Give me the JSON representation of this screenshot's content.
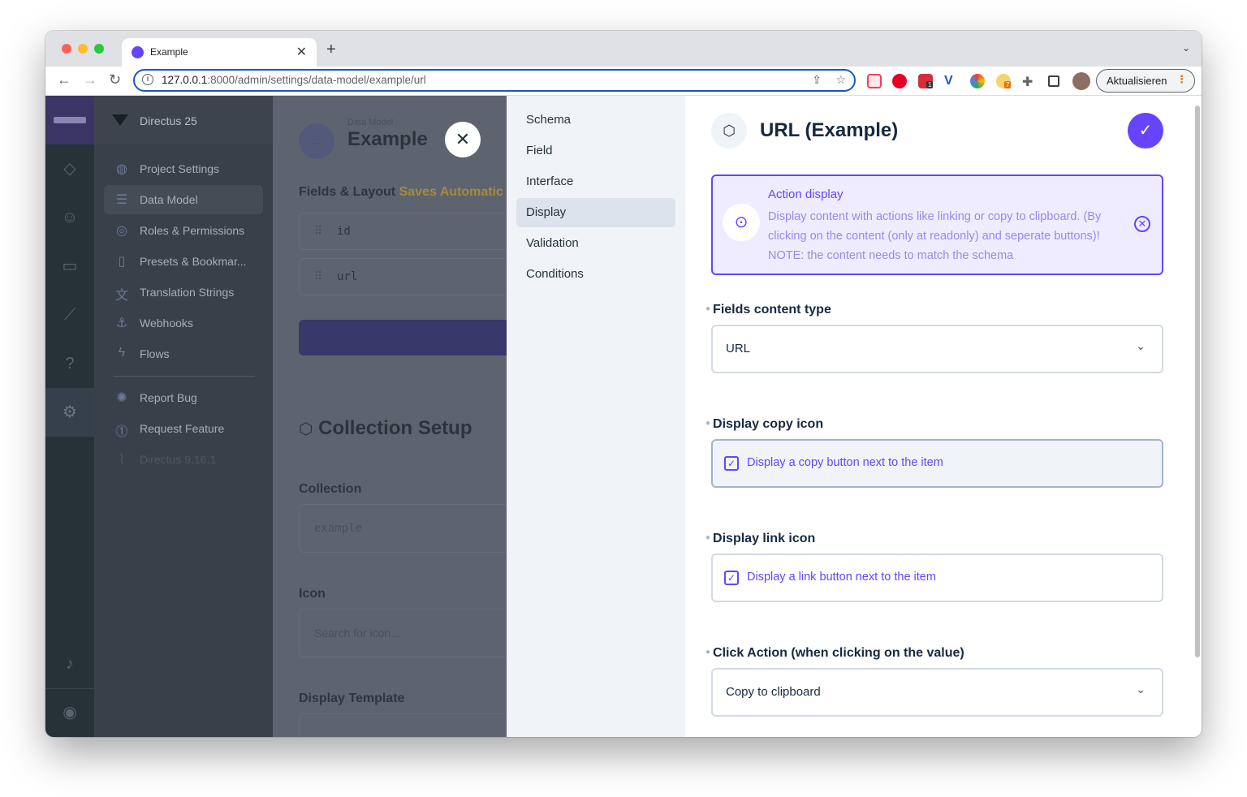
{
  "browser": {
    "tab_title": "Example",
    "url_host": "127.0.0.1",
    "url_rest": ":8000/admin/settings/data-model/example/url",
    "update_label": "Aktualisieren",
    "ext_badge_1": "1",
    "ext_badge_2": "7"
  },
  "sidebar": {
    "project_name": "Directus 25",
    "items": [
      {
        "label": "Project Settings",
        "icon": "globe-icon"
      },
      {
        "label": "Data Model",
        "icon": "list-icon"
      },
      {
        "label": "Roles & Permissions",
        "icon": "roles-icon"
      },
      {
        "label": "Presets & Bookmar...",
        "icon": "bookmark-icon"
      },
      {
        "label": "Translation Strings",
        "icon": "translate-icon"
      },
      {
        "label": "Webhooks",
        "icon": "anchor-icon"
      },
      {
        "label": "Flows",
        "icon": "bolt-icon"
      }
    ],
    "extra": [
      {
        "label": "Report Bug",
        "icon": "bug-icon"
      },
      {
        "label": "Request Feature",
        "icon": "feature-icon"
      },
      {
        "label": "Directus 9.16.1",
        "icon": "rabbit-icon"
      }
    ]
  },
  "main": {
    "breadcrumb": "Data Model",
    "title": "Example",
    "fields_layout_label": "Fields & Layout",
    "saves_label": "Saves Automatic",
    "fields": [
      "id",
      "url"
    ],
    "collection_setup_title": "Collection Setup",
    "collection_label": "Collection",
    "collection_value": "example",
    "icon_label": "Icon",
    "icon_placeholder": "Search for icon...",
    "display_template_label": "Display Template"
  },
  "drawer_tabs": [
    "Schema",
    "Field",
    "Interface",
    "Display",
    "Validation",
    "Conditions"
  ],
  "drawer": {
    "title": "URL (Example)",
    "notice": {
      "title": "Action display",
      "text": "Display content with actions like linking or copy to clipboard. (By clicking on the content (only at readonly) and seperate buttons)! NOTE: the content needs to match the schema"
    },
    "fields": {
      "content_type_label": "Fields content type",
      "content_type_value": "URL",
      "copy_icon_label": "Display copy icon",
      "copy_icon_text": "Display a copy button next to the item",
      "link_icon_label": "Display link icon",
      "link_icon_text": "Display a link button next to the item",
      "click_action_label": "Click Action (when clicking on the value)",
      "click_action_value": "Copy to clipboard"
    }
  },
  "colors": {
    "accent": "#6644ff",
    "notice_bg": "#f0ecff",
    "rail": "#263238"
  }
}
